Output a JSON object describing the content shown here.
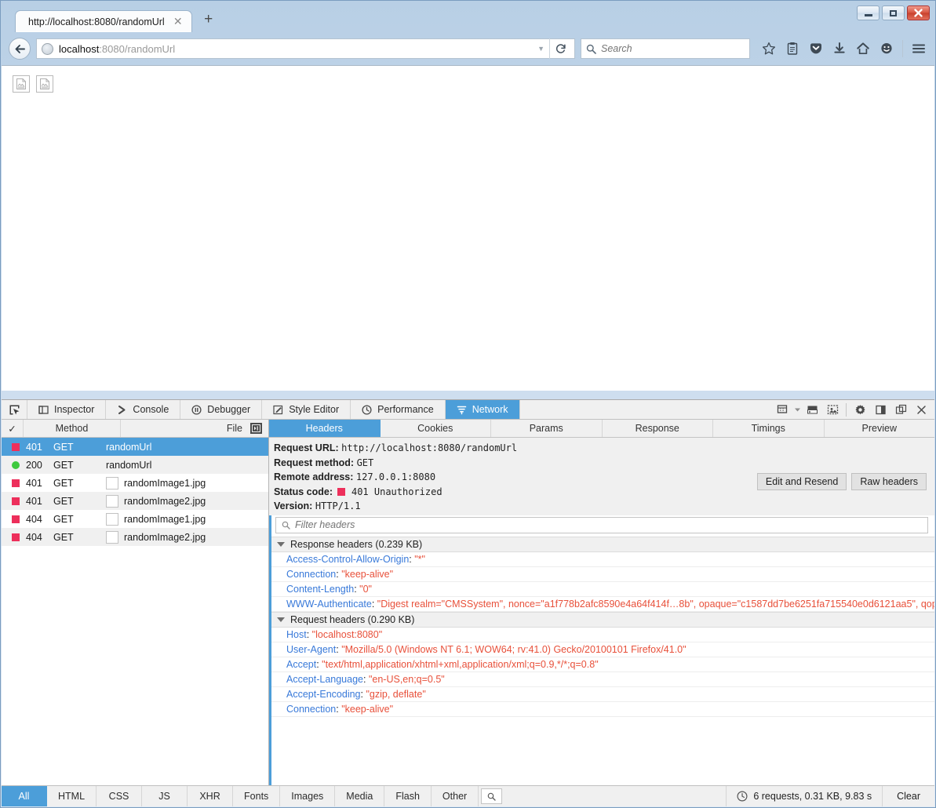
{
  "window": {
    "controls": {
      "minimize": "–",
      "maximize": "□",
      "close": "✕"
    }
  },
  "tabs": {
    "items": [
      {
        "title": "http://localhost:8080/randomUrl",
        "close": "✕"
      }
    ],
    "new_tab_label": "+"
  },
  "navbar": {
    "back_glyph": "←",
    "url_prefix": "localhost",
    "url_rest": ":8080/randomUrl",
    "url_full": "localhost:8080/randomUrl",
    "dropdown_glyph": "▼",
    "reload_glyph": "⟳",
    "search_placeholder": "Search",
    "search_value": "",
    "icons": [
      {
        "name": "bookmark-star-icon",
        "glyph": "☆"
      },
      {
        "name": "reader-list-icon",
        "glyph": "☰"
      },
      {
        "name": "pocket-icon",
        "glyph": "▽"
      },
      {
        "name": "downloads-icon",
        "glyph": "⬇"
      },
      {
        "name": "home-icon",
        "glyph": "⌂"
      },
      {
        "name": "hello-chat-icon",
        "glyph": "☺"
      },
      {
        "name": "hamburger-menu-icon",
        "glyph": "☰"
      }
    ]
  },
  "page": {
    "broken_images": [
      "randomImage1.jpg",
      "randomImage2.jpg"
    ]
  },
  "devtools": {
    "picker_icon": "node-picker-icon",
    "tabs": [
      {
        "label": "Inspector",
        "icon": "inspector-icon",
        "active": false
      },
      {
        "label": "Console",
        "icon": "console-chevron-icon",
        "active": false
      },
      {
        "label": "Debugger",
        "icon": "debugger-pause-icon",
        "active": false
      },
      {
        "label": "Style Editor",
        "icon": "style-editor-pencil-icon",
        "active": false
      },
      {
        "label": "Performance",
        "icon": "performance-clock-icon",
        "active": false
      },
      {
        "label": "Network",
        "icon": "network-filter-icon",
        "active": true
      }
    ],
    "tools": [
      {
        "name": "responsive-design-mode-icon"
      },
      {
        "name": "split-console-icon"
      },
      {
        "name": "screenshot-icon"
      },
      {
        "name": "settings-gear-icon"
      },
      {
        "name": "dock-side-icon"
      },
      {
        "name": "separate-window-icon"
      },
      {
        "name": "close-devtools-icon"
      }
    ],
    "requests": {
      "columns": {
        "check": "✓",
        "method": "Method",
        "file": "File"
      },
      "rows": [
        {
          "status": "401",
          "type": "error",
          "method": "GET",
          "file": "randomUrl",
          "thumb": false,
          "selected": true
        },
        {
          "status": "200",
          "type": "ok",
          "method": "GET",
          "file": "randomUrl",
          "thumb": false,
          "selected": false
        },
        {
          "status": "401",
          "type": "error",
          "method": "GET",
          "file": "randomImage1.jpg",
          "thumb": true,
          "selected": false
        },
        {
          "status": "401",
          "type": "error",
          "method": "GET",
          "file": "randomImage2.jpg",
          "thumb": true,
          "selected": false
        },
        {
          "status": "404",
          "type": "error",
          "method": "GET",
          "file": "randomImage1.jpg",
          "thumb": true,
          "selected": false
        },
        {
          "status": "404",
          "type": "error",
          "method": "GET",
          "file": "randomImage2.jpg",
          "thumb": true,
          "selected": false
        }
      ]
    },
    "detail_tabs": [
      {
        "label": "Headers",
        "active": true
      },
      {
        "label": "Cookies",
        "active": false
      },
      {
        "label": "Params",
        "active": false
      },
      {
        "label": "Response",
        "active": false
      },
      {
        "label": "Timings",
        "active": false
      },
      {
        "label": "Preview",
        "active": false
      }
    ],
    "summary": {
      "request_url_label": "Request URL:",
      "request_url_value": "http://localhost:8080/randomUrl",
      "request_method_label": "Request method:",
      "request_method_value": "GET",
      "remote_address_label": "Remote address:",
      "remote_address_value": "127.0.0.1:8080",
      "status_code_label": "Status code:",
      "status_code_value": "401 Unauthorized",
      "version_label": "Version:",
      "version_value": "HTTP/1.1"
    },
    "buttons": {
      "edit_and_resend": "Edit and Resend",
      "raw_headers": "Raw headers"
    },
    "filter_headers_placeholder": "Filter headers",
    "filter_headers_value": "",
    "response_headers": {
      "title": "Response headers (0.239 KB)",
      "rows": [
        {
          "name": "Access-Control-Allow-Origin",
          "value": "\"*\""
        },
        {
          "name": "Connection",
          "value": "\"keep-alive\""
        },
        {
          "name": "Content-Length",
          "value": "\"0\""
        },
        {
          "name": "WWW-Authenticate",
          "value": "\"Digest realm=\"CMSSystem\", nonce=\"a1f778b2afc8590e4a64f414f…8b\", opaque=\"c1587dd7be6251fa715540e0d6121aa5\", qop=\"auth\"\""
        }
      ]
    },
    "request_headers": {
      "title": "Request headers (0.290 KB)",
      "rows": [
        {
          "name": "Host",
          "value": "\"localhost:8080\""
        },
        {
          "name": "User-Agent",
          "value": "\"Mozilla/5.0 (Windows NT 6.1; WOW64; rv:41.0) Gecko/20100101 Firefox/41.0\""
        },
        {
          "name": "Accept",
          "value": "\"text/html,application/xhtml+xml,application/xml;q=0.9,*/*;q=0.8\""
        },
        {
          "name": "Accept-Language",
          "value": "\"en-US,en;q=0.5\""
        },
        {
          "name": "Accept-Encoding",
          "value": "\"gzip, deflate\""
        },
        {
          "name": "Connection",
          "value": "\"keep-alive\""
        }
      ]
    },
    "footer": {
      "filters": [
        {
          "label": "All",
          "active": true
        },
        {
          "label": "HTML",
          "active": false
        },
        {
          "label": "CSS",
          "active": false
        },
        {
          "label": "JS",
          "active": false
        },
        {
          "label": "XHR",
          "active": false
        },
        {
          "label": "Fonts",
          "active": false
        },
        {
          "label": "Images",
          "active": false
        },
        {
          "label": "Media",
          "active": false
        },
        {
          "label": "Flash",
          "active": false
        },
        {
          "label": "Other",
          "active": false
        }
      ],
      "search_icon": "search-icon",
      "status_text": "6 requests, 0.31 KB, 9.83 s",
      "clear_label": "Clear"
    }
  },
  "colors": {
    "accent": "#4c9ed9",
    "error": "#ed2f5b",
    "success": "#3ec93e",
    "header_name": "#3879d9",
    "header_value": "#e8503a"
  }
}
